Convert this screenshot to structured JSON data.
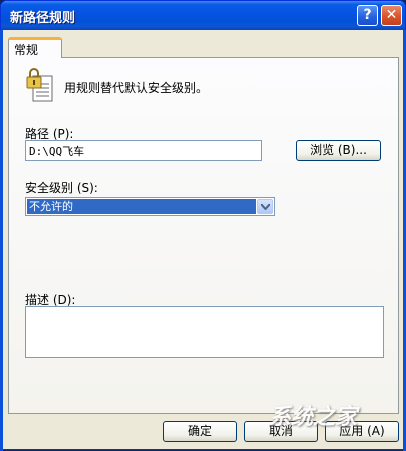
{
  "window": {
    "title": "新路径规则"
  },
  "titlebar": {
    "help_label": "?",
    "close_label": "✕"
  },
  "tabs": [
    {
      "label": "常规",
      "selected": true
    }
  ],
  "general": {
    "description": "用规则替代默认安全级别。",
    "path_label": "路径 (P):",
    "path_value": "D:\\QQ飞车",
    "browse_button": "浏览 (B)...",
    "security_label": "安全级别 (S):",
    "security_selected": "不允许的",
    "description_label": "描述 (D):",
    "description_value": ""
  },
  "footer": {
    "ok_label": "确定",
    "cancel_label": "取消",
    "apply_label": "应用 (A)"
  },
  "watermark": "系统之家",
  "colors": {
    "titlebar": "#0553e1",
    "selection": "#316ac5",
    "tab_highlight": "#f6b23a",
    "dialog_bg": "#ece9d8"
  },
  "icons": {
    "rule": "lock-document-icon",
    "dropdown": "chevron-down-icon"
  }
}
